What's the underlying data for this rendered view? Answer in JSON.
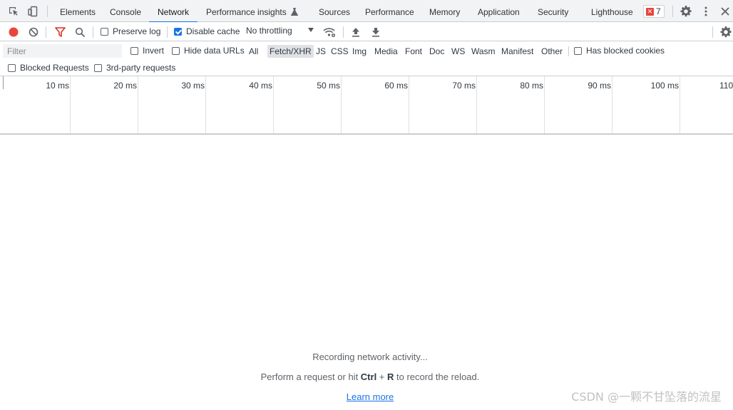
{
  "tabs": [
    {
      "label": "Elements",
      "active": false
    },
    {
      "label": "Console",
      "active": false
    },
    {
      "label": "Network",
      "active": true
    },
    {
      "label": "Performance insights",
      "active": false
    },
    {
      "label": "Sources",
      "active": false
    },
    {
      "label": "Performance",
      "active": false
    },
    {
      "label": "Memory",
      "active": false
    },
    {
      "label": "Application",
      "active": false
    },
    {
      "label": "Security",
      "active": false
    },
    {
      "label": "Lighthouse",
      "active": false
    }
  ],
  "error_count": "7",
  "toolbar": {
    "preserve_log": {
      "label": "Preserve log",
      "checked": false
    },
    "disable_cache": {
      "label": "Disable cache",
      "checked": true
    },
    "throttling": "No throttling"
  },
  "filter": {
    "placeholder": "Filter",
    "invert": {
      "label": "Invert",
      "checked": false
    },
    "hide_data_urls": {
      "label": "Hide data URLs",
      "checked": false
    },
    "types": [
      "All",
      "Fetch/XHR",
      "JS",
      "CSS",
      "Img",
      "Media",
      "Font",
      "Doc",
      "WS",
      "Wasm",
      "Manifest",
      "Other"
    ],
    "selected_type": "Fetch/XHR",
    "has_blocked_cookies": {
      "label": "Has blocked cookies",
      "checked": false
    },
    "blocked_requests": {
      "label": "Blocked Requests",
      "checked": false
    },
    "third_party": {
      "label": "3rd-party requests",
      "checked": false
    }
  },
  "timeline": {
    "ticks": [
      "10 ms",
      "20 ms",
      "30 ms",
      "40 ms",
      "50 ms",
      "60 ms",
      "70 ms",
      "80 ms",
      "90 ms",
      "100 ms",
      "110"
    ]
  },
  "empty_state": {
    "recording": "Recording network activity...",
    "hint_prefix": "Perform a request or hit ",
    "hint_key1": "Ctrl",
    "hint_plus": " + ",
    "hint_key2": "R",
    "hint_suffix": " to record the reload.",
    "learn_more": "Learn more"
  },
  "watermark": "CSDN @一颗不甘坠落的流星",
  "colors": {
    "accent": "#1a73e8",
    "record": "#e8453c",
    "filter_icon": "#d93025"
  }
}
